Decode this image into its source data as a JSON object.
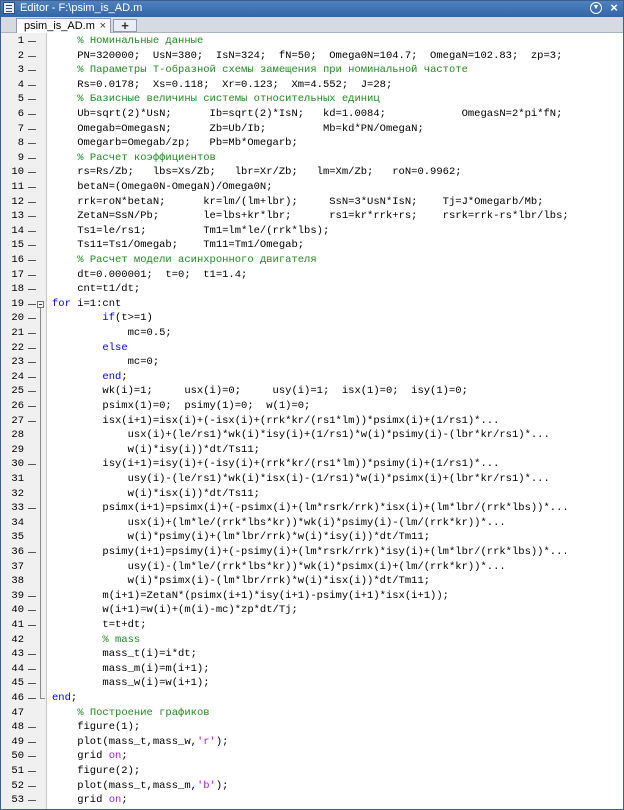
{
  "window": {
    "title": "Editor - F:\\psim_is_AD.m",
    "menu_icon": "dropdown-menu-icon",
    "close_icon": "close-icon"
  },
  "tabs": [
    {
      "label": "psim_is_AD.m",
      "close": "×"
    }
  ],
  "new_tab_label": "+",
  "editor": {
    "lines": [
      {
        "n": "1",
        "exec": true,
        "segs": [
          {
            "t": "    "
          },
          {
            "t": "% Номинальные данные",
            "c": "cmt"
          }
        ]
      },
      {
        "n": "2",
        "exec": true,
        "segs": [
          {
            "t": "    PN=320000;  UsN=380;  IsN=324;  fN=50;  Omega0N=104.7;  OmegaN=102.83;  zp=3;"
          }
        ]
      },
      {
        "n": "3",
        "exec": true,
        "segs": [
          {
            "t": "    "
          },
          {
            "t": "% Параметры Т-образной схемы замещения при номинальной частоте",
            "c": "cmt"
          }
        ]
      },
      {
        "n": "4",
        "exec": true,
        "segs": [
          {
            "t": "    Rs=0.0178;  Xs=0.118;  Xr=0.123;  Xm=4.552;  J=28;"
          }
        ]
      },
      {
        "n": "5",
        "exec": true,
        "segs": [
          {
            "t": "    "
          },
          {
            "t": "% Базисные величины системы относительных единиц",
            "c": "cmt"
          }
        ]
      },
      {
        "n": "6",
        "exec": true,
        "segs": [
          {
            "t": "    Ub=sqrt(2)*UsN;      Ib=sqrt(2)*IsN;   kd=1.0084;            OmegasN=2*pi*fN;"
          }
        ]
      },
      {
        "n": "7",
        "exec": true,
        "segs": [
          {
            "t": "    Omegab=OmegasN;      Zb=Ub/Ib;         Mb=kd*PN/OmegaN;"
          }
        ]
      },
      {
        "n": "8",
        "exec": true,
        "segs": [
          {
            "t": "    Omegarb=Omegab/zp;   Pb=Mb*Omegarb;"
          }
        ]
      },
      {
        "n": "9",
        "exec": true,
        "segs": [
          {
            "t": "    "
          },
          {
            "t": "% Расчет коэффициентов",
            "c": "cmt"
          }
        ]
      },
      {
        "n": "10",
        "exec": true,
        "segs": [
          {
            "t": "    rs=Rs/Zb;   lbs=Xs/Zb;   lbr=Xr/Zb;   lm=Xm/Zb;   roN=0.9962;"
          }
        ]
      },
      {
        "n": "11",
        "exec": true,
        "segs": [
          {
            "t": "    betaN=(Omega0N-OmegaN)/Omega0N;"
          }
        ]
      },
      {
        "n": "12",
        "exec": true,
        "segs": [
          {
            "t": "    rrk=roN*betaN;      kr=lm/(lm+lbr);     SsN=3*UsN*IsN;    Tj=J*Omegarb/Mb;"
          }
        ]
      },
      {
        "n": "13",
        "exec": true,
        "segs": [
          {
            "t": "    ZetaN=SsN/Pb;       le=lbs+kr*lbr;      rs1=kr*rrk+rs;    rsrk=rrk-rs*lbr/lbs;"
          }
        ]
      },
      {
        "n": "14",
        "exec": true,
        "segs": [
          {
            "t": "    Ts1=le/rs1;         Tm1=lm*le/(rrk*lbs);"
          }
        ]
      },
      {
        "n": "15",
        "exec": true,
        "segs": [
          {
            "t": "    Ts11=Ts1/Omegab;    Tm11=Tm1/Omegab;"
          }
        ]
      },
      {
        "n": "16",
        "exec": true,
        "segs": [
          {
            "t": "    "
          },
          {
            "t": "% Расчет модели асинхронного двигателя",
            "c": "cmt"
          }
        ]
      },
      {
        "n": "17",
        "exec": true,
        "segs": [
          {
            "t": "    dt=0.000001;  t=0;  t1=1.4;"
          }
        ]
      },
      {
        "n": "18",
        "exec": true,
        "segs": [
          {
            "t": "    cnt=t1/dt;"
          }
        ]
      },
      {
        "n": "19",
        "exec": true,
        "fold": "start",
        "segs": [
          {
            "t": "for",
            "c": "kw"
          },
          {
            "t": " i=1:cnt"
          }
        ]
      },
      {
        "n": "20",
        "exec": true,
        "segs": [
          {
            "t": "        "
          },
          {
            "t": "if",
            "c": "kw"
          },
          {
            "t": "(t>=1)"
          }
        ]
      },
      {
        "n": "21",
        "exec": true,
        "segs": [
          {
            "t": "            mc=0.5;"
          }
        ]
      },
      {
        "n": "22",
        "exec": true,
        "segs": [
          {
            "t": "        "
          },
          {
            "t": "else",
            "c": "kw"
          }
        ]
      },
      {
        "n": "23",
        "exec": true,
        "segs": [
          {
            "t": "            mc=0;"
          }
        ]
      },
      {
        "n": "24",
        "exec": true,
        "segs": [
          {
            "t": "        "
          },
          {
            "t": "end",
            "c": "kw"
          },
          {
            "t": ";"
          }
        ]
      },
      {
        "n": "25",
        "exec": true,
        "segs": [
          {
            "t": "        wk(i)=1;     usx(i)=0;     usy(i)=1;  isx(1)=0;  isy(1)=0;"
          }
        ]
      },
      {
        "n": "26",
        "exec": true,
        "segs": [
          {
            "t": "        psimx(1)=0;  psimy(1)=0;  w(1)=0;"
          }
        ]
      },
      {
        "n": "27",
        "exec": true,
        "segs": [
          {
            "t": "        isx(i+1)=isx(i)+(-isx(i)+(rrk*kr/(rs1*lm))*psimx(i)+(1/rs1)*..."
          }
        ]
      },
      {
        "n": "28",
        "exec": false,
        "segs": [
          {
            "t": "            usx(i)+(le/rs1)*wk(i)*isy(i)+(1/rs1)*w(i)*psimy(i)-(lbr*kr/rs1)*..."
          }
        ]
      },
      {
        "n": "29",
        "exec": false,
        "segs": [
          {
            "t": "            w(i)*isy(i))*dt/Ts11;"
          }
        ]
      },
      {
        "n": "30",
        "exec": true,
        "segs": [
          {
            "t": "        isy(i+1)=isy(i)+(-isy(i)+(rrk*kr/(rs1*lm))*psimy(i)+(1/rs1)*..."
          }
        ]
      },
      {
        "n": "31",
        "exec": false,
        "segs": [
          {
            "t": "            usy(i)-(le/rs1)*wk(i)*isx(i)-(1/rs1)*w(i)*psimx(i)+(lbr*kr/rs1)*..."
          }
        ]
      },
      {
        "n": "32",
        "exec": false,
        "segs": [
          {
            "t": "            w(i)*isx(i))*dt/Ts11;"
          }
        ]
      },
      {
        "n": "33",
        "exec": true,
        "segs": [
          {
            "t": "        psimx(i+1)=psimx(i)+(-psimx(i)+(lm*rsrk/rrk)*isx(i)+(lm*lbr/(rrk*lbs))*..."
          }
        ]
      },
      {
        "n": "34",
        "exec": false,
        "segs": [
          {
            "t": "            usx(i)+(lm*le/(rrk*lbs*kr))*wk(i)*psimy(i)-(lm/(rrk*kr))*..."
          }
        ]
      },
      {
        "n": "35",
        "exec": false,
        "segs": [
          {
            "t": "            w(i)*psimy(i)+(lm*lbr/rrk)*w(i)*isy(i))*dt/Tm11;"
          }
        ]
      },
      {
        "n": "36",
        "exec": true,
        "segs": [
          {
            "t": "        psimy(i+1)=psimy(i)+(-psimy(i)+(lm*rsrk/rrk)*isy(i)+(lm*lbr/(rrk*lbs))*..."
          }
        ]
      },
      {
        "n": "37",
        "exec": false,
        "segs": [
          {
            "t": "            usy(i)-(lm*le/(rrk*lbs*kr))*wk(i)*psimx(i)+(lm/(rrk*kr))*..."
          }
        ]
      },
      {
        "n": "38",
        "exec": false,
        "segs": [
          {
            "t": "            w(i)*psimx(i)-(lm*lbr/rrk)*w(i)*isx(i))*dt/Tm11;"
          }
        ]
      },
      {
        "n": "39",
        "exec": true,
        "segs": [
          {
            "t": "        m(i+1)=ZetaN*(psimx(i+1)*isy(i+1)-psimy(i+1)*isx(i+1));"
          }
        ]
      },
      {
        "n": "40",
        "exec": true,
        "segs": [
          {
            "t": "        w(i+1)=w(i)+(m(i)-mc)*zp*dt/Tj;"
          }
        ]
      },
      {
        "n": "41",
        "exec": true,
        "segs": [
          {
            "t": "        t=t+dt;"
          }
        ]
      },
      {
        "n": "42",
        "exec": false,
        "segs": [
          {
            "t": "        "
          },
          {
            "t": "% mass",
            "c": "cmt"
          }
        ]
      },
      {
        "n": "43",
        "exec": true,
        "segs": [
          {
            "t": "        mass_t(i)=i*dt;"
          }
        ]
      },
      {
        "n": "44",
        "exec": true,
        "segs": [
          {
            "t": "        mass_m(i)=m(i+1);"
          }
        ]
      },
      {
        "n": "45",
        "exec": true,
        "segs": [
          {
            "t": "        mass_w(i)=w(i+1);"
          }
        ]
      },
      {
        "n": "46",
        "exec": true,
        "fold": "end",
        "segs": [
          {
            "t": "end",
            "c": "kw"
          },
          {
            "t": ";"
          }
        ]
      },
      {
        "n": "47",
        "exec": false,
        "segs": [
          {
            "t": "    "
          },
          {
            "t": "% Построение графиков",
            "c": "cmt"
          }
        ]
      },
      {
        "n": "48",
        "exec": true,
        "segs": [
          {
            "t": "    figure(1);"
          }
        ]
      },
      {
        "n": "49",
        "exec": true,
        "segs": [
          {
            "t": "    plot(mass_t,mass_w,"
          },
          {
            "t": "'r'",
            "c": "str"
          },
          {
            "t": ");"
          }
        ]
      },
      {
        "n": "50",
        "exec": true,
        "segs": [
          {
            "t": "    grid "
          },
          {
            "t": "on",
            "c": "str"
          },
          {
            "t": ";"
          }
        ]
      },
      {
        "n": "51",
        "exec": true,
        "segs": [
          {
            "t": "    figure(2);"
          }
        ]
      },
      {
        "n": "52",
        "exec": true,
        "segs": [
          {
            "t": "    plot(mass_t,mass_m,"
          },
          {
            "t": "'b'",
            "c": "str"
          },
          {
            "t": ");"
          }
        ]
      },
      {
        "n": "53",
        "exec": true,
        "segs": [
          {
            "t": "    grid "
          },
          {
            "t": "on",
            "c": "str"
          },
          {
            "t": ";"
          }
        ]
      }
    ]
  },
  "colors": {
    "comment": "#228b22",
    "keyword": "#0000ff",
    "string": "#a020f0",
    "titlebar": "#3f74b5"
  }
}
